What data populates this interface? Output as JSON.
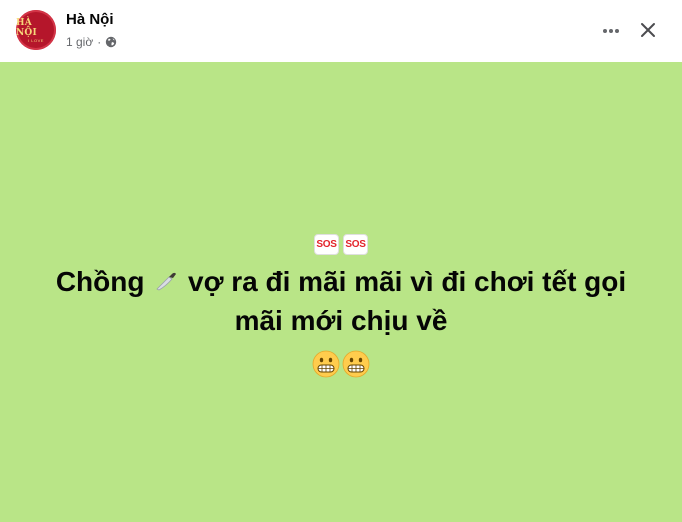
{
  "post": {
    "author": "Hà Nội",
    "avatar_text": "HÀ NỘI",
    "avatar_subtext": "I LOVE",
    "timestamp": "1 giờ",
    "audience_icon": "globe-icon",
    "actions": {
      "more_icon": "more-horizontal-icon",
      "close_icon": "close-icon"
    }
  },
  "content": {
    "background_color": "#b9e587",
    "sos_badges": [
      "SOS",
      "SOS"
    ],
    "text_part1": "Chồng",
    "text_part2": "vợ ra đi mãi mãi vì đi chơi tết gọi",
    "text_line2": "mãi mới chịu về",
    "inline_emoji": "knife-icon",
    "trailing_emojis": [
      "grimacing-face-icon",
      "grimacing-face-icon"
    ]
  }
}
